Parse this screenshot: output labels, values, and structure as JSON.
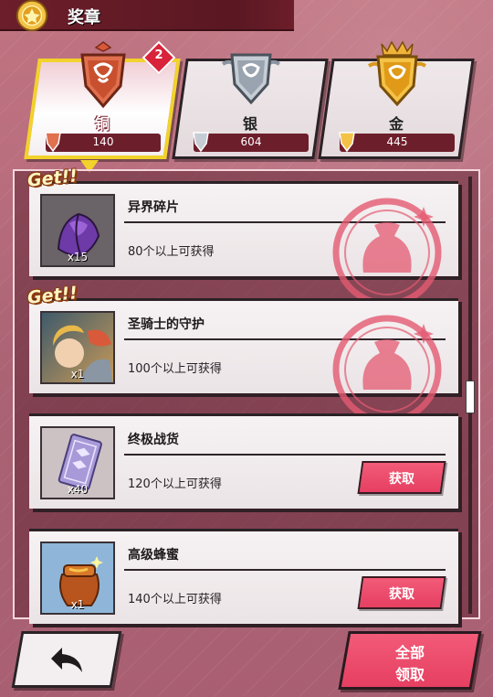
{
  "header": {
    "title": "奖章",
    "icon": "gold-medal-icon"
  },
  "tabs": [
    {
      "name": "铜",
      "count": "140",
      "icon": "bronze-medal-icon",
      "active": true,
      "color": "#e0704e"
    },
    {
      "name": "银",
      "count": "604",
      "icon": "silver-medal-icon",
      "active": false,
      "color": "#b9c2cc"
    },
    {
      "name": "金",
      "count": "445",
      "icon": "gold-medal-icon",
      "active": false,
      "color": "#f0b33a"
    }
  ],
  "badge": {
    "value": "2"
  },
  "items": [
    {
      "name": "异界碎片",
      "qty": "x15",
      "requirement": "80个以上可获得",
      "status": "received",
      "tag": "Get!!",
      "icon": "purple-cloth-icon"
    },
    {
      "name": "圣骑士的守护",
      "qty": "x1",
      "requirement": "100个以上可获得",
      "status": "received",
      "tag": "Get!!",
      "icon": "character-portrait-icon"
    },
    {
      "name": "终极战货",
      "qty": "x40",
      "requirement": "120个以上可获得",
      "status": "claimable",
      "claim_label": "获取",
      "icon": "ticket-card-icon"
    },
    {
      "name": "高级蜂蜜",
      "qty": "x1",
      "requirement": "140个以上可获得",
      "status": "claimable",
      "claim_label": "获取",
      "icon": "honey-jar-icon"
    }
  ],
  "footer": {
    "back_icon": "back-arrow-icon",
    "claim_all_line1": "全部",
    "claim_all_line2": "领取"
  },
  "colors": {
    "accent": "#e63f61",
    "active_border": "#f2d22b",
    "header_bg": "#5a1822"
  }
}
